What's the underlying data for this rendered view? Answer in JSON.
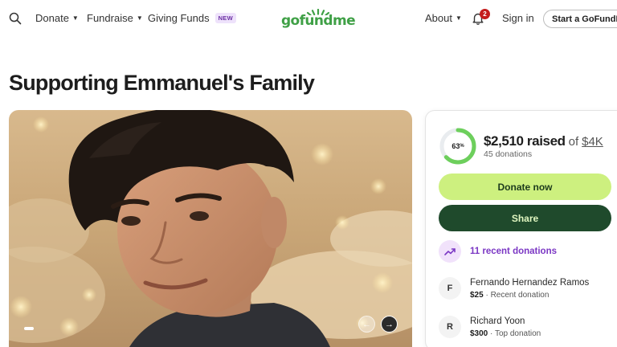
{
  "header": {
    "nav": [
      {
        "label": "Donate"
      },
      {
        "label": "Fundraise"
      },
      {
        "label": "Giving Funds",
        "badge": "NEW"
      }
    ],
    "logo": "gofundme",
    "notifications_count": "2",
    "about_label": "About",
    "signin_label": "Sign in",
    "start_label": "Start a GoFundMe"
  },
  "page": {
    "title": "Supporting Emmanuel's Family"
  },
  "carousel": {
    "prev_icon": "arrow-left-icon",
    "next_icon": "arrow-right-icon"
  },
  "donation_card": {
    "percent": "63",
    "percent_value": 0.63,
    "raised": "$2,510 raised",
    "of_label": "of",
    "goal": "$4K",
    "donation_count": "45 donations",
    "donate_label": "Donate now",
    "share_label": "Share",
    "recent_label": "11 recent donations",
    "donors": [
      {
        "initial": "F",
        "name": "Fernando Hernandez Ramos",
        "amount": "$25",
        "tag": "Recent donation"
      },
      {
        "initial": "R",
        "name": "Richard Yoon",
        "amount": "$300",
        "tag": "Top donation"
      }
    ]
  },
  "colors": {
    "brand_green": "#3fa046",
    "donate_button": "#cdf07f",
    "share_button": "#1f4a2c",
    "accent_purple": "#7b37c4",
    "notification_red": "#c41b1b"
  }
}
